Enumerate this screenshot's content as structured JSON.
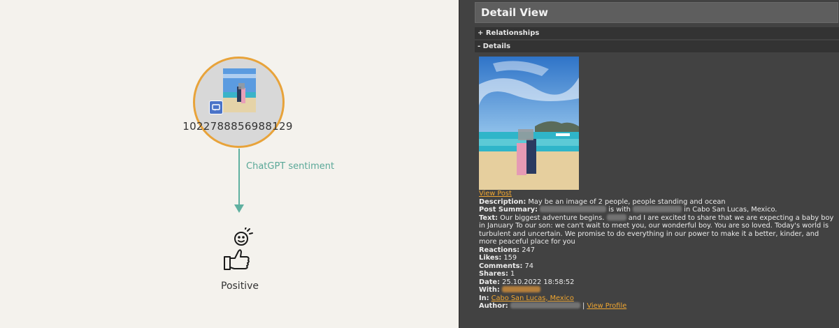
{
  "graph": {
    "node_id": "1022788856988129",
    "edge_label": "ChatGPT sentiment",
    "sentiment_label": "Positive"
  },
  "detail": {
    "title": "Detail View",
    "sections": {
      "relationships": "+ Relationships",
      "details": "- Details"
    },
    "view_post": "View Post",
    "description_key": "Description:",
    "description_val": "May be an image of 2 people, people standing and ocean",
    "summary_key": "Post Summary:",
    "summary_mid": "is with",
    "summary_end": "in Cabo San Lucas, Mexico.",
    "text_key": "Text:",
    "text_part1": "Our biggest adventure begins.",
    "text_part2": "and I are excited to share that we are expecting a baby boy in January     To our son: we can't wait to meet you, our wonderful boy. You are so loved. Today's world is turbulent and uncertain. We promise to do everything in our power to make it a better, kinder, and more peaceful place for you",
    "reactions_key": "Reactions:",
    "reactions_val": "247",
    "likes_key": "Likes:",
    "likes_val": "159",
    "comments_key": "Comments:",
    "comments_val": "74",
    "shares_key": "Shares:",
    "shares_val": "1",
    "date_key": "Date:",
    "date_val": "25.10.2022 18:58:52",
    "with_key": "With:",
    "in_key": "In:",
    "in_val": "Cabo San Lucas, Mexico",
    "author_key": "Author:",
    "author_sep": "|",
    "view_profile": "View Profile"
  }
}
